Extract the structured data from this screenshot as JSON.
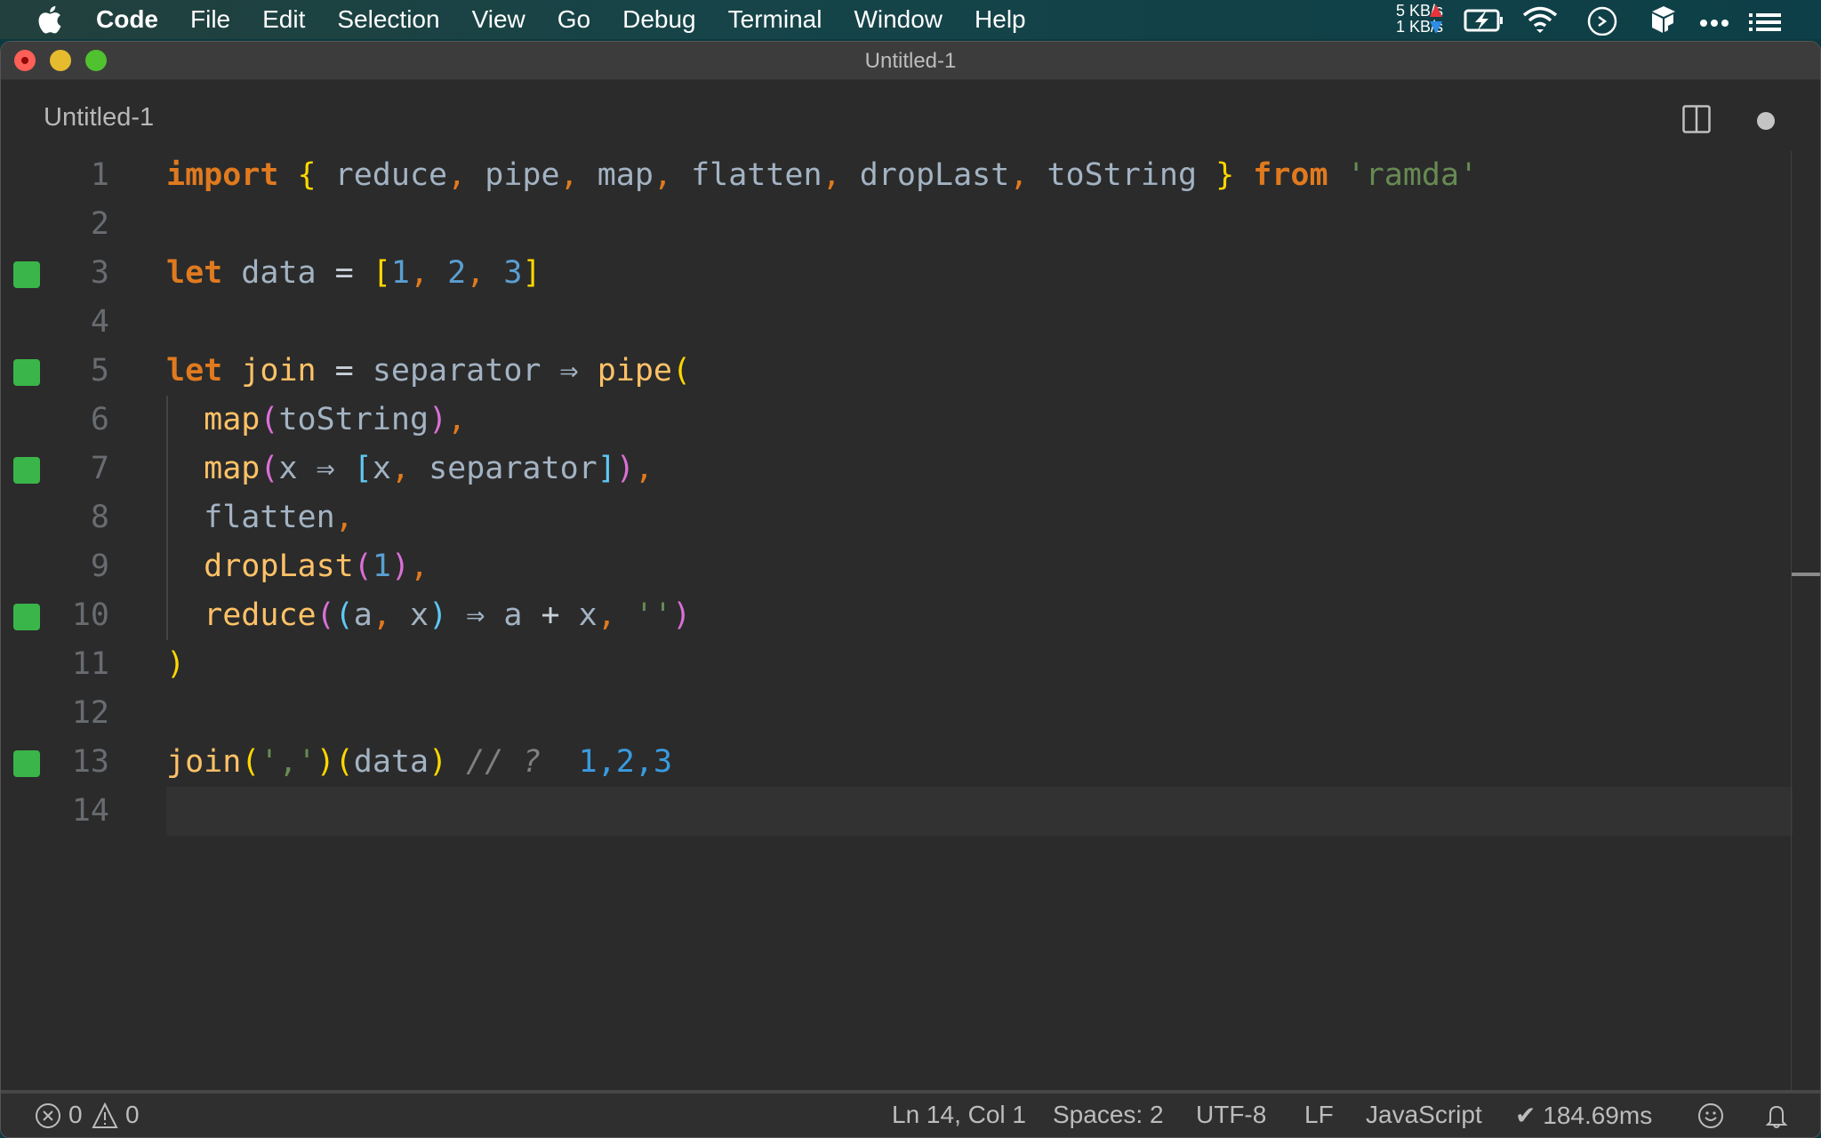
{
  "menubar": {
    "app_name": "Code",
    "items": [
      "File",
      "Edit",
      "Selection",
      "View",
      "Go",
      "Debug",
      "Terminal",
      "Window",
      "Help"
    ],
    "net_up": "5 KB/s",
    "net_down": "1 KB/s",
    "status_icons": [
      "battery-charging-icon",
      "wifi-icon",
      "terminal-clock-icon",
      "box-icon",
      "more-dots-icon",
      "list-icon"
    ]
  },
  "window": {
    "title": "Untitled-1",
    "tab_title": "Untitled-1",
    "tab_dirty": true
  },
  "editor": {
    "language": "JavaScript",
    "current_line": 14,
    "lines": [
      {
        "n": "1",
        "marker": false
      },
      {
        "n": "2",
        "marker": false
      },
      {
        "n": "3",
        "marker": true
      },
      {
        "n": "4",
        "marker": false
      },
      {
        "n": "5",
        "marker": true
      },
      {
        "n": "6",
        "marker": false
      },
      {
        "n": "7",
        "marker": true
      },
      {
        "n": "8",
        "marker": false
      },
      {
        "n": "9",
        "marker": false
      },
      {
        "n": "10",
        "marker": true
      },
      {
        "n": "11",
        "marker": false
      },
      {
        "n": "12",
        "marker": false
      },
      {
        "n": "13",
        "marker": true
      },
      {
        "n": "14",
        "marker": false
      }
    ],
    "code_text": [
      "import { reduce, pipe, map, flatten, dropLast, toString } from 'ramda'",
      "",
      "let data = [1, 2, 3]",
      "",
      "let join = separator ⇒ pipe(",
      "  map(toString),",
      "  map(x ⇒ [x, separator]),",
      "  flatten,",
      "  dropLast(1),",
      "  reduce((a, x) ⇒ a + x, '')",
      ")",
      "",
      "join(',')(data) // ?  1,2,3",
      ""
    ],
    "tokens": {
      "l1": [
        "import",
        " ",
        "{",
        " reduce",
        ",",
        " pipe",
        ",",
        " map",
        ",",
        " flatten",
        ",",
        " dropLast",
        ",",
        " toString ",
        "}",
        " ",
        "from",
        " ",
        "'ramda'"
      ],
      "l3": [
        "let",
        " data ",
        "=",
        " ",
        "[",
        "1",
        ",",
        " ",
        "2",
        ",",
        " ",
        "3",
        "]"
      ],
      "l5": [
        "let",
        " ",
        "join",
        " ",
        "=",
        " separator ",
        "⇒",
        " ",
        "pipe",
        "("
      ],
      "l6": [
        "  ",
        "map",
        "(",
        "toString",
        ")",
        ","
      ],
      "l7": [
        "  ",
        "map",
        "(",
        "x ",
        "⇒",
        " ",
        "[",
        "x",
        ",",
        " separator",
        "]",
        ")",
        ","
      ],
      "l8": [
        "  ",
        "flatten",
        ","
      ],
      "l9": [
        "  ",
        "dropLast",
        "(",
        "1",
        ")",
        ","
      ],
      "l10": [
        "  ",
        "reduce",
        "(",
        "(",
        "a",
        ",",
        " x",
        ")",
        " ",
        "⇒",
        " a ",
        "+",
        " x",
        ",",
        " ",
        "''",
        ")"
      ],
      "l11": [
        ")"
      ],
      "l13": [
        "join",
        "(",
        "','",
        ")",
        "(",
        "data",
        ")",
        " ",
        "// ?",
        "  ",
        "1,2,3"
      ]
    },
    "inline_result": "1,2,3"
  },
  "statusbar": {
    "errors": "0",
    "warnings": "0",
    "cursor": "Ln 14, Col 1",
    "indent": "Spaces: 2",
    "encoding": "UTF-8",
    "eol": "LF",
    "language": "JavaScript",
    "timing": "✔ 184.69ms"
  },
  "colors": {
    "keyword": "#e07a1f",
    "function": "#ffc267",
    "identifier": "#a3b3c3",
    "string": "#678b53",
    "number": "#5a9fd1",
    "bracket_level1": "#ffd700",
    "bracket_level2": "#da70d6",
    "bracket_level3": "#5fc8f5",
    "coverage_marker": "#3ab54a",
    "editor_bg": "#2b2b2b"
  }
}
